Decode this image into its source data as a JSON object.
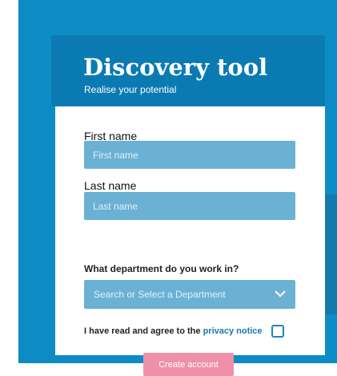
{
  "header": {
    "title": "Discovery tool",
    "subtitle": "Realise your potential"
  },
  "form": {
    "first_name": {
      "label": "First name",
      "placeholder": "First name",
      "value": ""
    },
    "last_name": {
      "label": "Last name",
      "placeholder": "Last name",
      "value": ""
    },
    "department": {
      "label": "What department do you work in?",
      "selected": "Search or Select a Department"
    },
    "agreement": {
      "text": "I have read and agree to the ",
      "link_text": "privacy notice",
      "checked": false
    },
    "submit_label": "Create account"
  },
  "colors": {
    "page_background": "#0d8bc4",
    "header_background": "#0a7bb2",
    "field_background": "#6bb1d3",
    "link": "#1a7ab0",
    "button": "#ee90aa"
  }
}
